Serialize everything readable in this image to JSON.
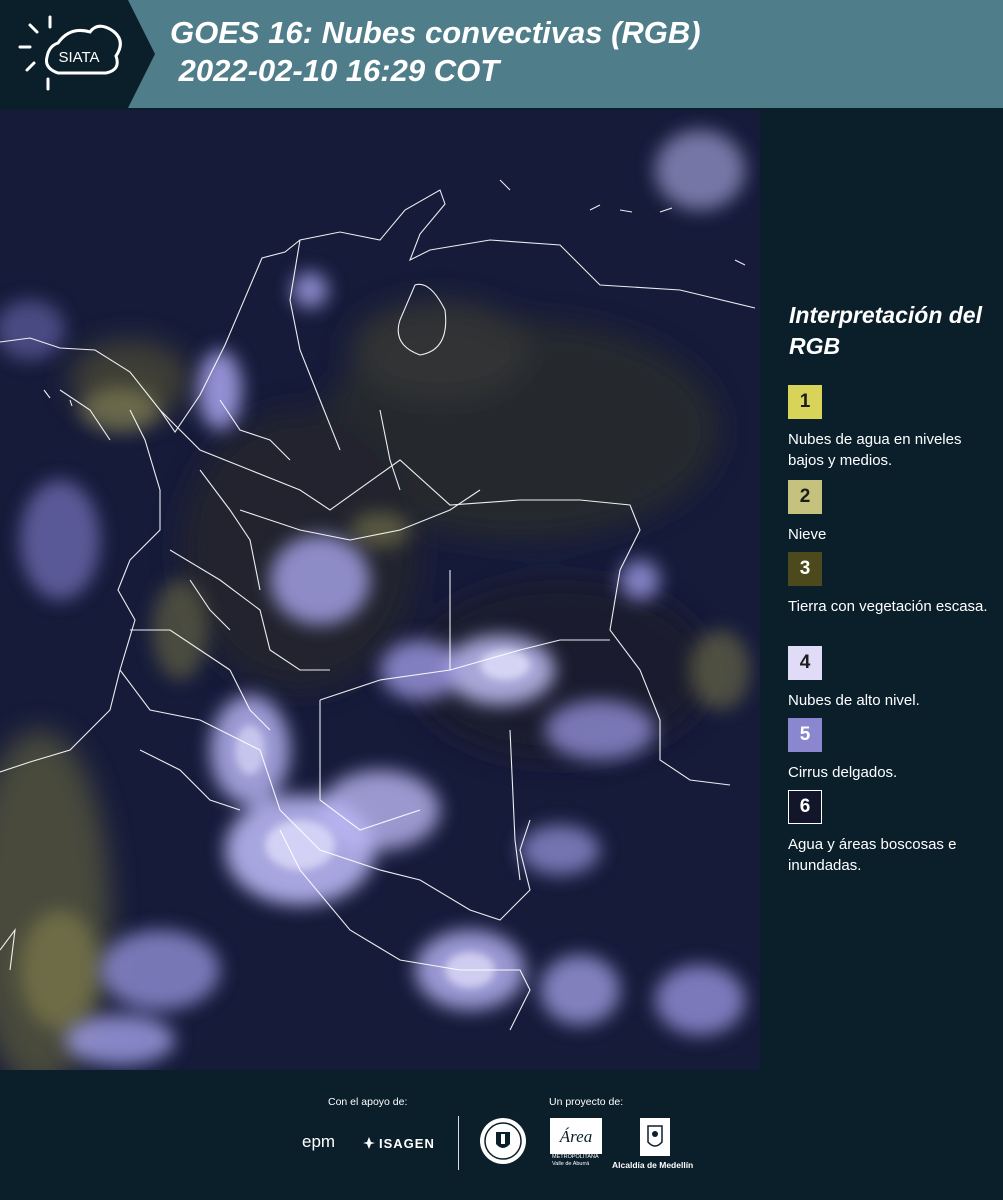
{
  "header": {
    "logo_text": "SIATA",
    "title_line1": "GOES 16: Nubes convectivas (RGB)",
    "title_line2": " 2022-02-10 16:29 COT"
  },
  "legend": {
    "title": "Interpretación del RGB",
    "items": [
      {
        "number": "1",
        "description": "Nubes de agua en niveles bajos y medios.",
        "color": "#d8d45a",
        "text_color": "#1c1c1c"
      },
      {
        "number": "2",
        "description": "Nieve",
        "color": "#c4c27c",
        "text_color": "#1c1c1c"
      },
      {
        "number": "3",
        "description": "Tierra con vegetación escasa.",
        "color": "#4c4a1c",
        "text_color": "#ffffff"
      },
      {
        "number": "4",
        "description": "Nubes de alto nivel.",
        "color": "#e0dcf8",
        "text_color": "#1c1c1c"
      },
      {
        "number": "5",
        "description": "Cirrus delgados.",
        "color": "#8a86d0",
        "text_color": "#ffffff"
      },
      {
        "number": "6",
        "description": "Agua y áreas boscosas e inundadas.",
        "color": "#13152a",
        "text_color": "#ffffff"
      }
    ]
  },
  "footer": {
    "support_label": "Con el apoyo de:",
    "project_label": "Un proyecto de:",
    "sponsors": [
      "epm",
      "ISAGEN"
    ],
    "partners": {
      "area_line1": "METROPOLITANA",
      "area_line2": "Valle de Aburrá",
      "alcaldia": "Alcaldía de Medellín"
    }
  },
  "colors": {
    "header_bg": "#4f7d8a",
    "panel_bg": "#0b1f2b",
    "map_bg": "#141a38"
  }
}
